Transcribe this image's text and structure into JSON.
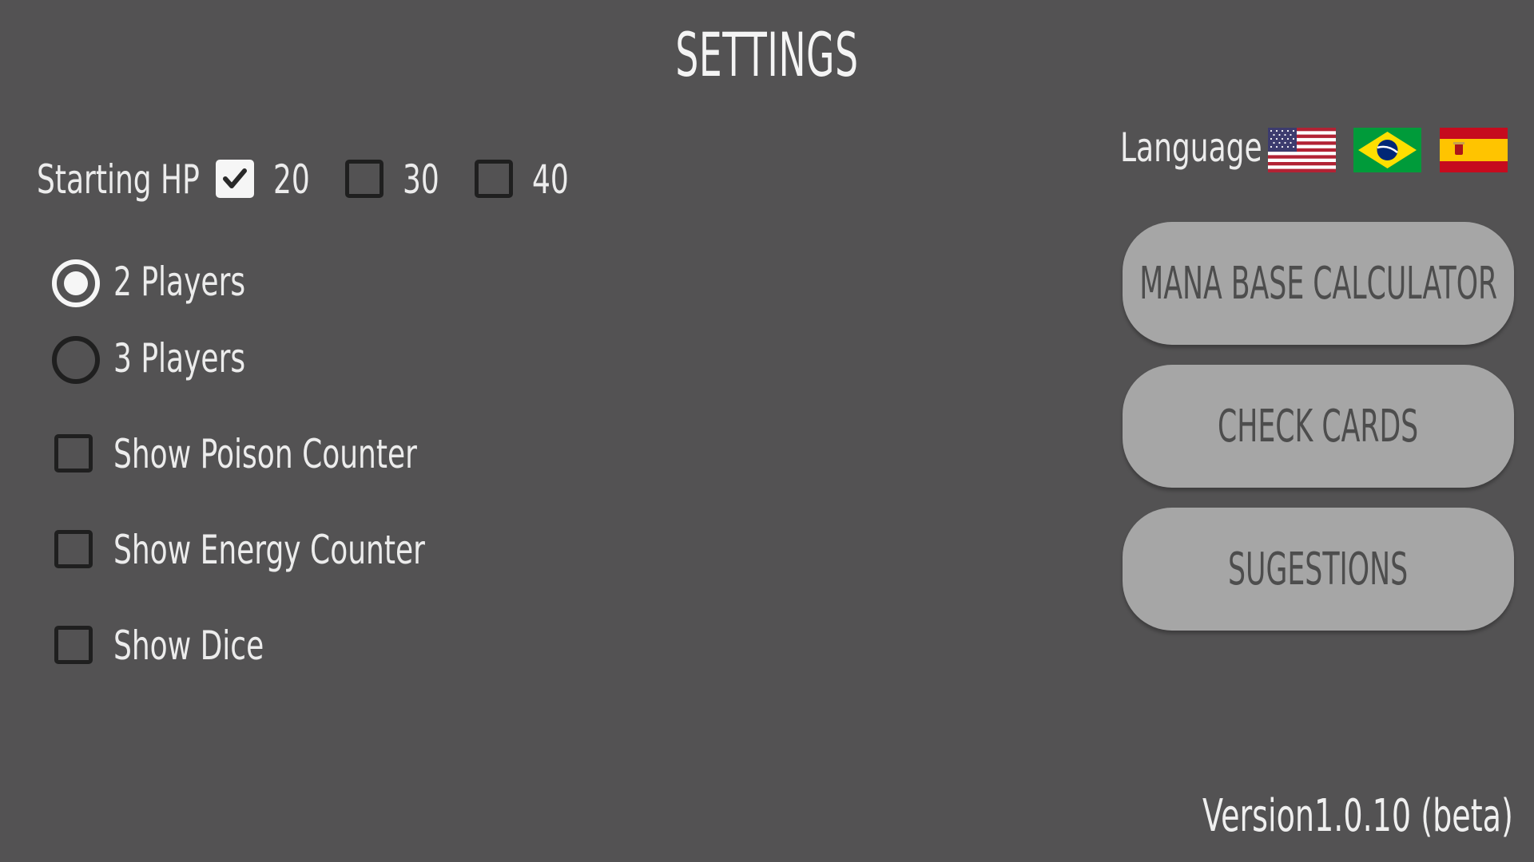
{
  "title": "SETTINGS",
  "starting_hp": {
    "label": "Starting HP",
    "options": [
      {
        "label": "20",
        "checked": true
      },
      {
        "label": "30",
        "checked": false
      },
      {
        "label": "40",
        "checked": false
      }
    ]
  },
  "players": [
    {
      "label": "2 Players",
      "selected": true
    },
    {
      "label": "3 Players",
      "selected": false
    }
  ],
  "toggles": [
    {
      "label": "Show Poison Counter",
      "checked": false
    },
    {
      "label": "Show Energy Counter",
      "checked": false
    },
    {
      "label": "Show Dice",
      "checked": false
    }
  ],
  "language": {
    "label": "Language",
    "flags": [
      "us-flag-icon",
      "brazil-flag-icon",
      "spain-flag-icon"
    ]
  },
  "buttons": {
    "mana": "MANA BASE CALCULATOR",
    "check": "CHECK CARDS",
    "suggestions": "SUGESTIONS"
  },
  "version": "Version1.0.10 (beta)",
  "colors": {
    "background": "#535253",
    "button": "#a6a6a6",
    "button_text": "#4d4d4d",
    "text": "#efefef"
  }
}
